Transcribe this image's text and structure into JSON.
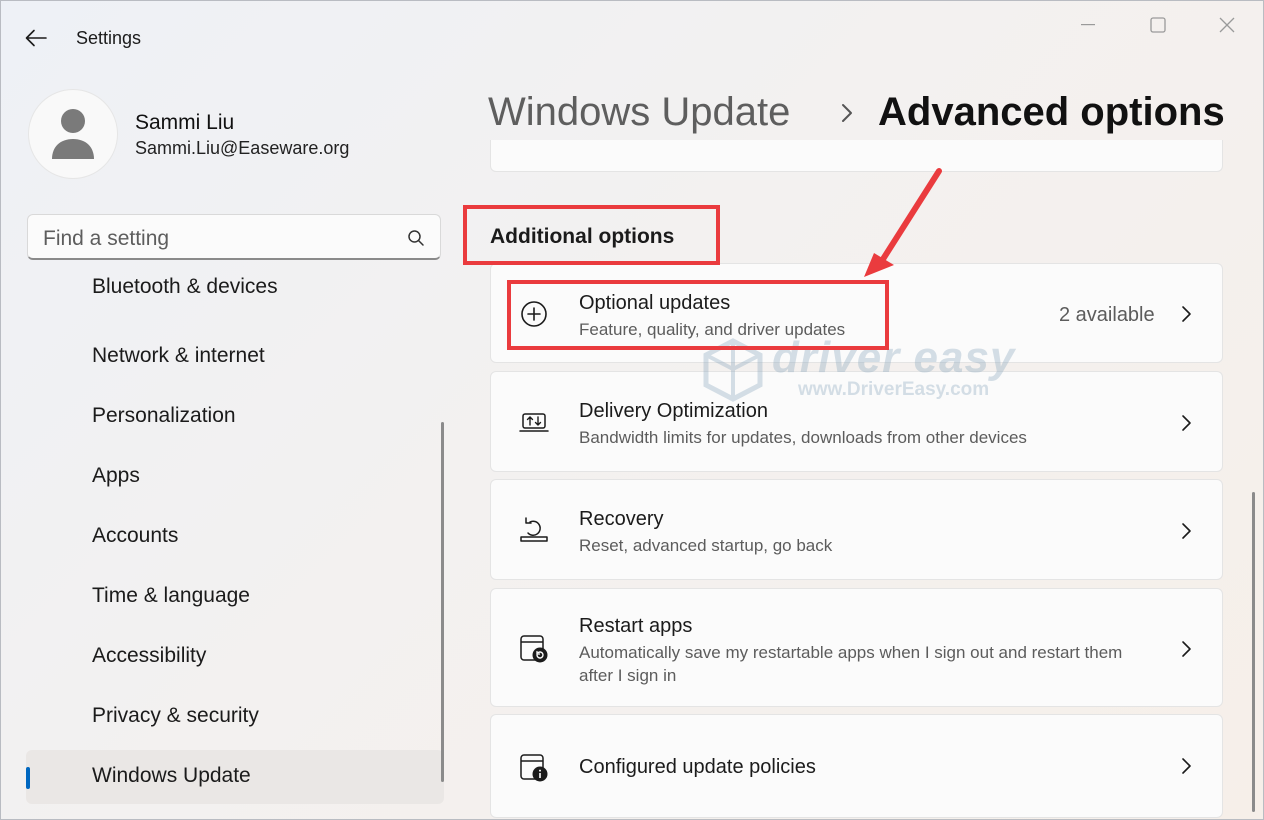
{
  "window": {
    "app_title": "Settings",
    "controls": [
      "minimize",
      "maximize",
      "close"
    ]
  },
  "user": {
    "name": "Sammi Liu",
    "email": "Sammi.Liu@Easeware.org"
  },
  "search": {
    "placeholder": "Find a setting"
  },
  "nav": {
    "items": [
      {
        "label": "Bluetooth & devices"
      },
      {
        "label": "Network & internet"
      },
      {
        "label": "Personalization"
      },
      {
        "label": "Apps"
      },
      {
        "label": "Accounts"
      },
      {
        "label": "Time & language"
      },
      {
        "label": "Accessibility"
      },
      {
        "label": "Privacy & security"
      },
      {
        "label": "Windows Update"
      }
    ],
    "active": "Windows Update"
  },
  "header": {
    "parent": "Windows Update",
    "current": "Advanced options"
  },
  "section": {
    "heading": "Additional options"
  },
  "cards": [
    {
      "title": "Optional updates",
      "desc": "Feature, quality, and driver updates",
      "value": "2 available",
      "icon": "plus-circle-icon"
    },
    {
      "title": "Delivery Optimization",
      "desc": "Bandwidth limits for updates, downloads from other devices",
      "icon": "delivery-optimization-icon"
    },
    {
      "title": "Recovery",
      "desc": "Reset, advanced startup, go back",
      "icon": "recovery-icon"
    },
    {
      "title": "Restart apps",
      "desc": "Automatically save my restartable apps when I sign out and restart them after I sign in",
      "icon": "restart-apps-icon"
    },
    {
      "title": "Configured update policies",
      "icon": "policy-info-icon"
    }
  ],
  "watermark": {
    "brand": "driver easy",
    "url": "www.DriverEasy.com"
  },
  "colors": {
    "accent": "#0067c0",
    "annotation_red": "#ea3b3e"
  }
}
